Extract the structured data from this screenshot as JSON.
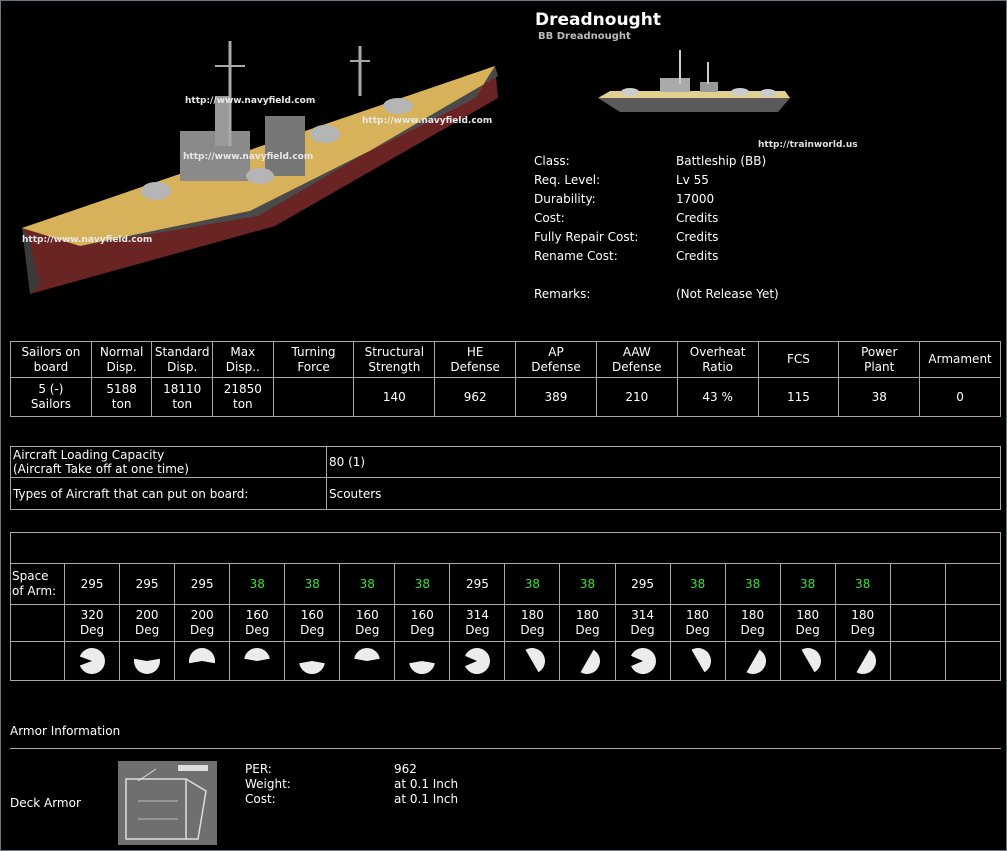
{
  "ship": {
    "name": "Dreadnought",
    "code": "BB Dreadnought",
    "watermark": "http://www.navyfield.com",
    "thumb_url": "http://trainworld.us"
  },
  "info": [
    {
      "label": "Class:",
      "value": "Battleship (BB)"
    },
    {
      "label": "Req. Level:",
      "value": "Lv 55"
    },
    {
      "label": "Durability:",
      "value": "17000"
    },
    {
      "label": "Cost:",
      "value": "Credits"
    },
    {
      "label": "Fully Repair Cost:",
      "value": "Credits"
    },
    {
      "label": "Rename Cost:",
      "value": "Credits"
    },
    {
      "label": "Remarks:",
      "value": "(Not Release Yet)"
    }
  ],
  "stats": {
    "headers": [
      [
        "Sailors on",
        "board"
      ],
      [
        "Normal",
        "Disp."
      ],
      [
        "Standard",
        "Disp."
      ],
      [
        "Max",
        "Disp.."
      ],
      [
        "Turning",
        "Force"
      ],
      [
        "Structural",
        "Strength"
      ],
      [
        "HE",
        "Defense"
      ],
      [
        "AP",
        "Defense"
      ],
      [
        "AAW",
        "Defense"
      ],
      [
        "Overheat",
        "Ratio"
      ],
      [
        "FCS",
        ""
      ],
      [
        "Power",
        "Plant"
      ],
      [
        "Armament",
        ""
      ]
    ],
    "values": [
      [
        "5 (-)",
        "Sailors"
      ],
      [
        "5188",
        "ton"
      ],
      [
        "18110",
        "ton"
      ],
      [
        "21850",
        "ton"
      ],
      [
        "",
        ""
      ],
      [
        "140",
        ""
      ],
      [
        "962",
        ""
      ],
      [
        "389",
        ""
      ],
      [
        "210",
        ""
      ],
      [
        "43 %",
        ""
      ],
      [
        "115",
        ""
      ],
      [
        "38",
        ""
      ],
      [
        "0",
        ""
      ]
    ]
  },
  "aircraft": {
    "capacity_label_1": "Aircraft Loading Capacity",
    "capacity_label_2": "(Aircraft Take off at one time)",
    "capacity_value": "80 (1)",
    "types_label": "Types of Aircraft that can put on board:",
    "types_value": "Scouters"
  },
  "armament": {
    "space_label_1": "Space",
    "space_label_2": "of Arm:",
    "slots": [
      {
        "space": "295",
        "green": false,
        "deg": "320",
        "arc": 320,
        "dir": 90
      },
      {
        "space": "295",
        "green": false,
        "deg": "200",
        "arc": 200,
        "dir": 180
      },
      {
        "space": "295",
        "green": false,
        "deg": "200",
        "arc": 200,
        "dir": 0
      },
      {
        "space": "38",
        "green": true,
        "deg": "160",
        "arc": 160,
        "dir": 0
      },
      {
        "space": "38",
        "green": true,
        "deg": "160",
        "arc": 160,
        "dir": 180
      },
      {
        "space": "38",
        "green": true,
        "deg": "160",
        "arc": 160,
        "dir": 0
      },
      {
        "space": "38",
        "green": true,
        "deg": "160",
        "arc": 160,
        "dir": 180
      },
      {
        "space": "295",
        "green": false,
        "deg": "314",
        "arc": 314,
        "dir": 90
      },
      {
        "space": "38",
        "green": true,
        "deg": "180",
        "arc": 180,
        "dir": 60
      },
      {
        "space": "38",
        "green": true,
        "deg": "180",
        "arc": 180,
        "dir": 120
      },
      {
        "space": "295",
        "green": false,
        "deg": "314",
        "arc": 314,
        "dir": 90
      },
      {
        "space": "38",
        "green": true,
        "deg": "180",
        "arc": 180,
        "dir": 60
      },
      {
        "space": "38",
        "green": true,
        "deg": "180",
        "arc": 180,
        "dir": 120
      },
      {
        "space": "38",
        "green": true,
        "deg": "180",
        "arc": 180,
        "dir": 60
      },
      {
        "space": "38",
        "green": true,
        "deg": "180",
        "arc": 180,
        "dir": 120
      },
      {
        "space": "",
        "green": false,
        "deg": "",
        "arc": 0,
        "dir": 0
      },
      {
        "space": "",
        "green": false,
        "deg": "",
        "arc": 0,
        "dir": 0
      }
    ],
    "deg_unit": "Deg"
  },
  "armor": {
    "heading": "Armor Information",
    "deck_label": "Deck Armor",
    "rows": [
      {
        "label": "PER:",
        "value": "962"
      },
      {
        "label": "Weight:",
        "value": "at 0.1 Inch"
      },
      {
        "label": "Cost:",
        "value": "at 0.1 Inch"
      }
    ]
  },
  "colors": {
    "background": "#000000",
    "border": "#a8a8a8",
    "green_value": "#39e139",
    "deck_yellow": "#e0b95a",
    "hull_red": "#7a2a2a"
  }
}
